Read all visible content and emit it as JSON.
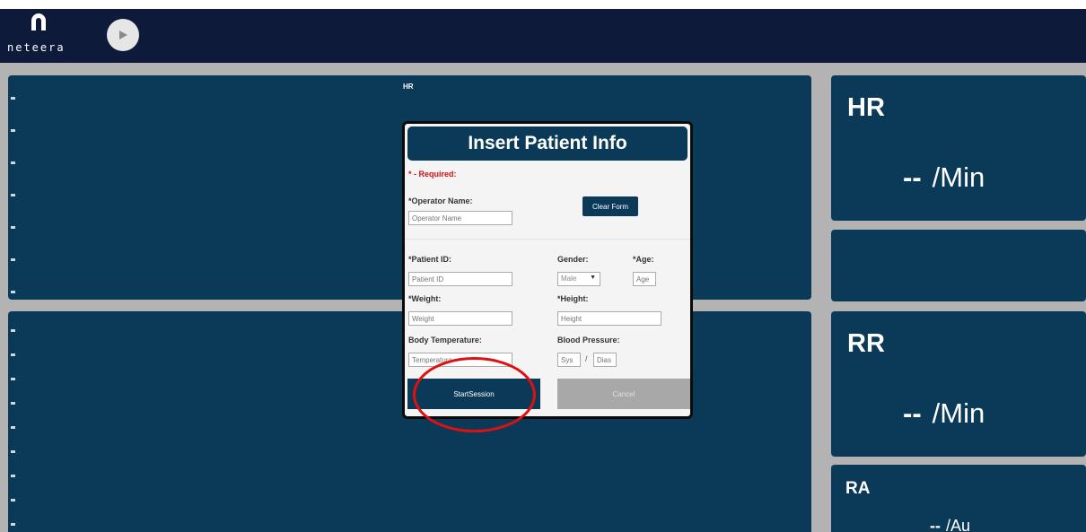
{
  "header": {
    "logo_text": "neteera",
    "play_icon": "play-icon"
  },
  "charts": {
    "top_title": "HR"
  },
  "stats": {
    "hr": {
      "label": "HR",
      "value": "--",
      "unit": "/Min"
    },
    "rr": {
      "label": "RR",
      "value": "--",
      "unit": "/Min"
    },
    "ra": {
      "label": "RA",
      "value": "--",
      "unit": "/Au"
    }
  },
  "modal": {
    "title": "Insert Patient Info",
    "required_note": "* - Required:",
    "operator_label": "*Operator Name:",
    "operator_placeholder": "Operator Name",
    "clear_button": "Clear Form",
    "patient_id_label": "*Patient ID:",
    "patient_id_placeholder": "Patient ID",
    "gender_label": "Gender:",
    "gender_value": "Male",
    "age_label": "*Age:",
    "age_placeholder": "Age",
    "weight_label": "*Weight:",
    "weight_placeholder": "Weight",
    "height_label": "*Height:",
    "height_placeholder": "Height",
    "body_temp_label": "Body Temperature:",
    "body_temp_placeholder": "Temperature",
    "blood_pressure_label": "Blood Pressure:",
    "sys_placeholder": "Sys",
    "dia_placeholder": "Dias",
    "bp_separator": "/",
    "start_button": "StartSession",
    "cancel_button": "Cancel"
  },
  "colors": {
    "topbar": "#0e1a3a",
    "panel": "#0b3a58",
    "background": "#b3b3b3",
    "highlight": "#e01010"
  }
}
